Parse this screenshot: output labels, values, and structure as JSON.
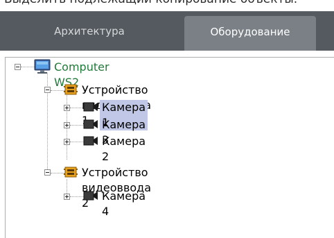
{
  "caption": "Выделить подлежащии копирование объекты.",
  "tabs": [
    {
      "label": "Архитектура",
      "active": false
    },
    {
      "label": "Оборудование",
      "active": true
    }
  ],
  "tree": {
    "computer": {
      "label": "Computer WS2",
      "icon": "computer-icon",
      "color": "#227a3a"
    },
    "device1": {
      "label": "Устройство видеоввода 1",
      "icon": "capture-card-icon"
    },
    "cam1": {
      "label": "Камера 1",
      "icon": "camera-icon",
      "selected": true
    },
    "cam3": {
      "label": "Камера 3",
      "icon": "camera-icon"
    },
    "cam2": {
      "label": "Камера 2",
      "icon": "camera-icon"
    },
    "device2": {
      "label": "Устройство видеоввода 2",
      "icon": "capture-card-icon"
    },
    "cam4": {
      "label": "Камера 4",
      "icon": "camera-icon"
    }
  },
  "colors": {
    "tabbar": "#545a60",
    "active_tab": "#7b8086",
    "selection": "#c1c7e6"
  }
}
